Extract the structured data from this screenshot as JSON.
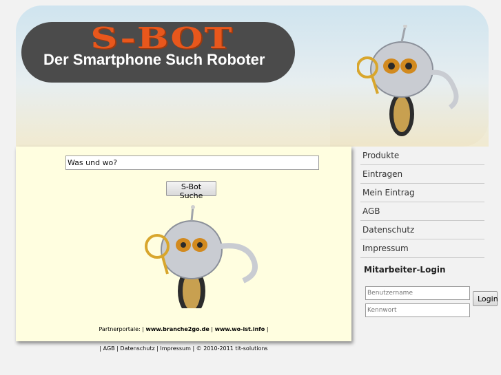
{
  "logo": {
    "title": "S-BOT",
    "subtitle": "Der Smartphone Such Roboter"
  },
  "search": {
    "value": "Was und wo?",
    "button_label": "S-Bot Suche"
  },
  "partner": {
    "prefix": "Partnerportale: |",
    "link1": "www.branche2go.de",
    "sep": "|",
    "link2": "www.wo-ist.info",
    "suffix": "|"
  },
  "nav": {
    "items": [
      {
        "label": "Produkte"
      },
      {
        "label": "Eintragen"
      },
      {
        "label": "Mein Eintrag"
      },
      {
        "label": "AGB"
      },
      {
        "label": "Datenschutz"
      },
      {
        "label": "Impressum"
      }
    ]
  },
  "login": {
    "title": "Mitarbeiter-Login",
    "user_placeholder": "Benutzername",
    "pass_placeholder": "Kennwort",
    "button_label": "Login"
  },
  "footer": {
    "text": "| AGB | Datenschutz | Impressum | © 2010-2011 tit-solutions"
  }
}
